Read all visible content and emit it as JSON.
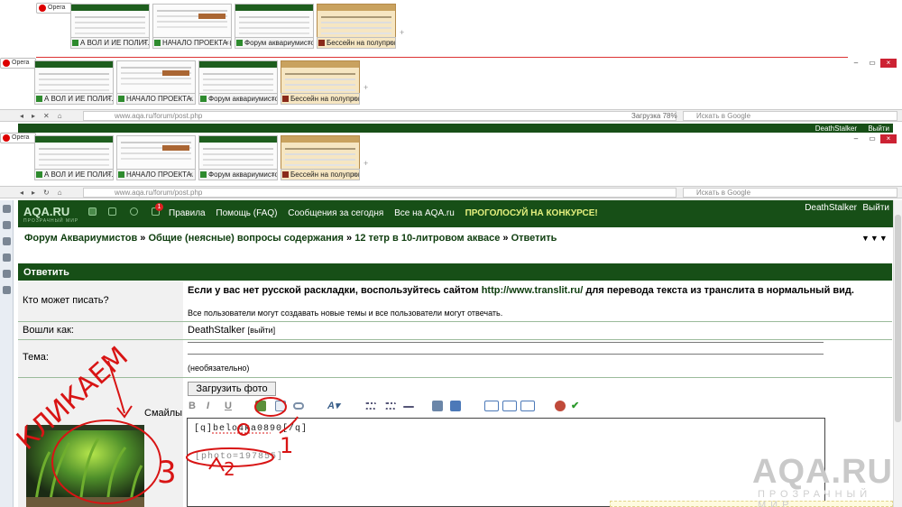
{
  "opera": {
    "logo": "Opera"
  },
  "tab_strips": [
    {
      "tabs": [
        "А ВОЛ И ИЕ ПОЛИТ...",
        "НАЧАЛО ПРОЕКТА (...",
        "Форум аквариумисто...",
        "Бессейн на полупрогр..."
      ]
    },
    {
      "tabs": [
        "А ВОЛ И ИЕ ПОЛИТ...",
        "НАЧАЛО ПРОЕКТА. (...",
        "Форум аквариумисто...",
        "Бессейн на полупрогр..."
      ]
    },
    {
      "tabs": [
        "А ВОЛ И ИЕ ПОЛИТ...",
        "НАЧАЛО ПРОЕКТА. (...",
        "Форум аквариумисто...",
        "Бессейн на полупрогр..."
      ]
    }
  ],
  "address_bars": [
    {
      "url": "www.aqa.ru/forum/post.php",
      "search": "Искать в Google",
      "zoom": "Загрузка  78%"
    },
    {
      "url": "www.aqa.ru/forum/post.php",
      "search": "Искать в Google"
    }
  ],
  "top_strip_header": {
    "user": "DeathStalker",
    "logout": "Выйти"
  },
  "header": {
    "logo": "AQA.RU",
    "logo_sub": "ПРОЗРАЧНЫЙ МИР",
    "badge_count": "1",
    "nav": [
      "Правила",
      "Помощь (FAQ)",
      "Сообщения за сегодня",
      "Все на AQA.ru"
    ],
    "promo": "ПРОГОЛОСУЙ НА КОНКУРСЕ!",
    "user": "DeathStalker",
    "logout": "Выйти"
  },
  "breadcrumb": {
    "items": [
      "Форум Аквариумистов",
      "Общие (неясные) вопросы содержания",
      "12 тетр в 10-литровом аквасе",
      "Ответить"
    ],
    "sep": "»",
    "tools": "▼▼▼"
  },
  "reply": {
    "title": "Ответить",
    "who_can_post_label": "Кто может писать?",
    "hint_bold_start": "Если у вас нет русской раскладки, воспользуйтесь сайтом",
    "hint_link": "http://www.translit.ru/",
    "hint_bold_end": "для перевода текста из транслита в нормальный вид.",
    "hint_small": "Все пользователи могут создавать новые темы и все пользователи могут отвечать.",
    "logged_in_label": "Вошли как:",
    "logged_in_user": "DeathStalker",
    "logged_in_logout": "[выйти]",
    "topic_label": "Тема:",
    "topic_hint": "(необязательно)",
    "upload_button": "Загрузить фото",
    "smiles_label": "Смайлы",
    "editor_line1": "[q]belo4ka0890[/q]",
    "editor_line2": "[photo=197855]"
  },
  "annotations": {
    "word": "КЛИКАЕМ",
    "n1": "1",
    "n2": "2",
    "n3": "3",
    "color": "#d81414"
  },
  "watermark": {
    "main": "AQA.RU",
    "sub": "ПРОЗРАЧНЫЙ МИР"
  },
  "colors": {
    "header_green": "#174f17",
    "annotation_red": "#d81414"
  }
}
